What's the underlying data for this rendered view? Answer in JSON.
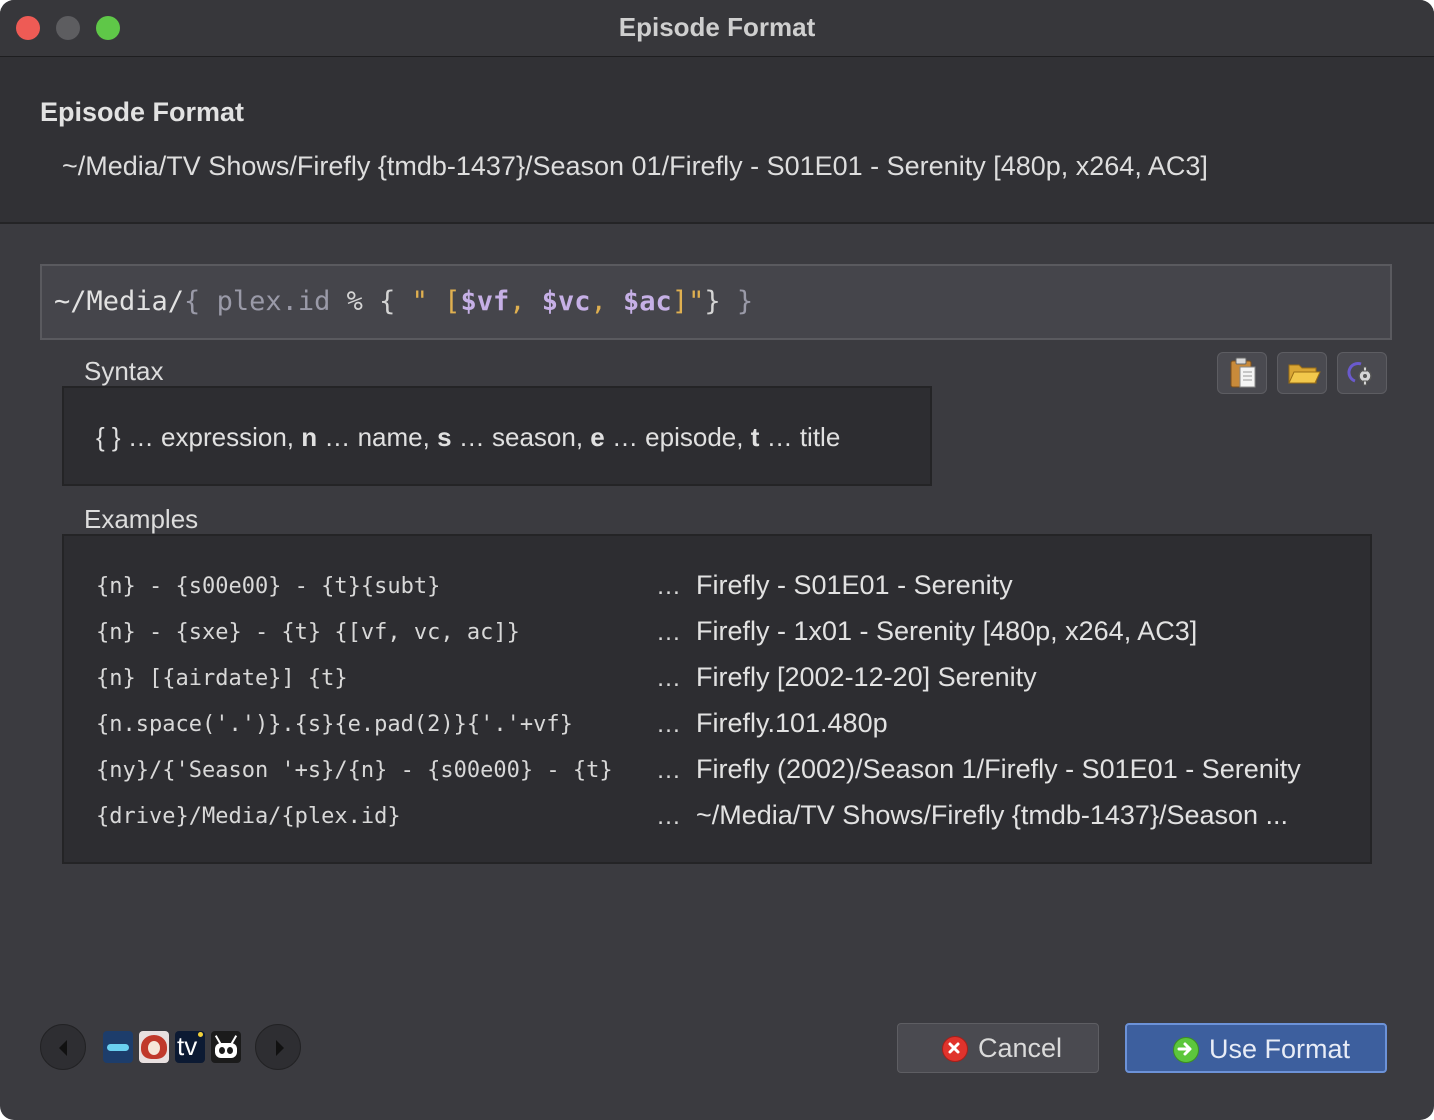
{
  "window": {
    "title": "Episode Format"
  },
  "header": {
    "title": "Episode Format",
    "preview_path": "~/Media/TV Shows/Firefly {tmdb-1437}/Season 01/Firefly - S01E01 - Serenity [480p, x264, AC3]"
  },
  "format_input": {
    "path_prefix": "~/Media/",
    "brace_open": "{",
    "expr": " plex.id ",
    "op": "%",
    "inner_open": " { ",
    "quote_open": "\" [",
    "var1": "$vf",
    "sep1": ", ",
    "var2": "$vc",
    "sep2": ", ",
    "var3": "$ac",
    "quote_close": "]\"",
    "inner_close": "} ",
    "brace_close": "}"
  },
  "syntax": {
    "label": "Syntax",
    "braces": "{ }",
    "expr_desc": " … expression, ",
    "n_key": "n",
    "n_desc": " … name, ",
    "s_key": "s",
    "s_desc": " … season, ",
    "e_key": "e",
    "e_desc": " … episode, ",
    "t_key": "t",
    "t_desc": " … title"
  },
  "toolbar": {
    "paste_icon": "clipboard-icon",
    "open_icon": "folder-icon",
    "script_icon": "script-gear-icon"
  },
  "examples": {
    "label": "Examples",
    "dots": "…",
    "rows": [
      {
        "code": "{n} - {s00e00} - {t}{subt}",
        "result": "Firefly - S01E01 - Serenity"
      },
      {
        "code": "{n} - {sxe} - {t} {[vf, vc, ac]}",
        "result": "Firefly - 1x01 - Serenity [480p, x264, AC3]"
      },
      {
        "code": "{n} [{airdate}] {t}",
        "result": "Firefly [2002-12-20] Serenity"
      },
      {
        "code": "{n.space('.')}.{s}{e.pad(2)}{'.'+vf}",
        "result": "Firefly.101.480p"
      },
      {
        "code": "{ny}/{'Season '+s}/{n} - {s00e00} - {t}",
        "result": "Firefly (2002)/Season 1/Firefly - S01E01 - Serenity"
      },
      {
        "code": "{drive}/Media/{plex.id}",
        "result": "~/Media/TV Shows/Firefly {tmdb-1437}/Season ..."
      }
    ]
  },
  "datasources": {
    "prev_icon": "triangle-left-icon",
    "next_icon": "triangle-right-icon",
    "sources": [
      "tvdb-icon",
      "anidb-icon",
      "tvmaze-icon",
      "trakt-icon"
    ],
    "tv_glyph": "tv"
  },
  "buttons": {
    "cancel": "Cancel",
    "use_format": "Use Format"
  },
  "colors": {
    "window_bg": "#3b3b40",
    "string": "#e0b050",
    "variable": "#c6b0e6",
    "primary_button": "#3d5f9e"
  }
}
